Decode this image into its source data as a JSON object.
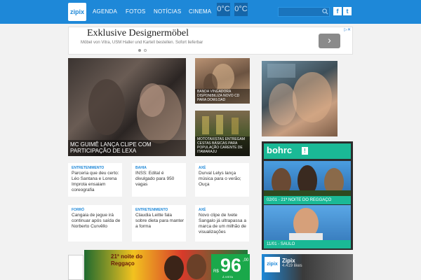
{
  "header": {
    "logo_text": "zipix",
    "nav": [
      "AGENDA",
      "FOTOS",
      "NOTÍCIAS",
      "CINEMA"
    ],
    "temps": [
      "0°C",
      "0°C"
    ],
    "search_placeholder": "",
    "social": [
      "f",
      "t"
    ],
    "accent_color": "#1e88d8"
  },
  "ad": {
    "title": "Exklusive Designermöbel",
    "subtitle": "Möbel von Vitra, USM Haller und Kartell bestellen. Sofort lieferbar",
    "arrow": "›",
    "close": "▷✕"
  },
  "features": {
    "main_caption": "MC GUIMÊ LANÇA CLIPE COM PARTICIPAÇÃO DE LEXA",
    "side1_caption": "BANDA VINGADORA DISPONIBILIZA NOVO CD PARA DOWLOAD",
    "side2_caption": "MOTOTAXISTAS ENTREGAM CESTAS BÁSICAS PARA POPULAÇÃO CARENTE DE ITAMARAJU"
  },
  "cards": [
    {
      "category": "ENTRETENIMENTO",
      "text": "Parceria que deu certo: Léo Santana e Lorena Improta ensaiam coreografia"
    },
    {
      "category": "BAHIA",
      "text": "INSS: Edital é divulgado para 950 vagas"
    },
    {
      "category": "AXÉ",
      "text": "Durval Lelys lança música para o verão; Ouça"
    },
    {
      "category": "FORRÓ",
      "text": "Cangaia de jegue irá continuar após saída de Norberto Curvêllo"
    },
    {
      "category": "ENTRETENIMENTO",
      "text": "Claudia Leitte fala sobre dieta para manter a forma"
    },
    {
      "category": "AXÉ",
      "text": "Novo clipe de Ivete Sangalo já ultrapassa a marca de um milhão de visualizações"
    }
  ],
  "bohr": {
    "logo": "bohrc",
    "badge": "!",
    "items": [
      {
        "label": "02/01 - 21ª NOITE DO REGGAÇO"
      },
      {
        "label": "11/01 - SAULO"
      }
    ]
  },
  "bottom": {
    "event": "21ª noite do Reggaço",
    "price_prefix": "R$",
    "price": "96",
    "price_cents": ",00",
    "price_note": "À VISTA",
    "zipix_logo": "Zipix",
    "zipix_likes": "4.419 likes"
  }
}
